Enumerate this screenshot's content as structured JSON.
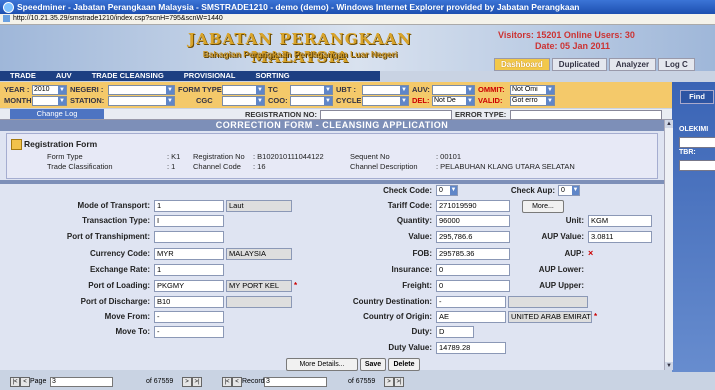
{
  "window": {
    "title": "Speedminer - Jabatan Perangkaan Malaysia - SMSTRADE1210 - demo (demo) - Windows Internet Explorer provided by Jabatan Perangkaan",
    "url": "http://10.21.35.29/smstrade1210/index.csp?scnH=795&scnW=1440"
  },
  "header": {
    "agency": "JABATAN PERANGKAAN MALAYSIA",
    "subtitle": "Bahagian Perangkaan Perdagangan Luar Negeri",
    "visitors": "Visitors: 15201  Online Users: 30",
    "date": "Date: 05 Jan 2011",
    "tabs": [
      "Dashboard",
      "Duplicated",
      "Analyzer",
      "Log C"
    ]
  },
  "menu": [
    "TRADE",
    "AUV",
    "TRADE CLEANSING",
    "PROVISIONAL",
    "SORTING"
  ],
  "filters": {
    "year_label": "YEAR :",
    "year_value": "2010",
    "month_label": "MONTH:",
    "negeri_label": "NEGERI :",
    "station_label": "STATION:",
    "form_type_label": "FORM TYPE:",
    "cgc_label": "CGC",
    "tc_label": "TC",
    "coo_label": "COO:",
    "ubt_label": "UBT :",
    "cycle_label": "CYCLE:",
    "auv_label": "AUV:",
    "del_label": "DEL:",
    "del_value": "Not De",
    "ommit_label": "OMMIT:",
    "ommit_value": "Not Omi",
    "valid_label": "VALID:",
    "valid_value": "Got erro"
  },
  "side": {
    "find": "Find",
    "olekim": "OLEKIMI",
    "tbr": "TBR:"
  },
  "regbar": {
    "change_log": "Change Log",
    "reg_no_label": "REGISTRATION NO:",
    "error_type_label": "ERROR TYPE:"
  },
  "form_title": "CORRECTION FORM - CLEANSING APPLICATION",
  "registration": {
    "title": "Registration Form",
    "form_type_label": "Form Type",
    "form_type_value": ": K1",
    "reg_no_label": "Registration No",
    "reg_no_value": ": B102010111044122",
    "sequent_label": "Sequent No",
    "sequent_value": ": 00101",
    "trade_class_label": "Trade Classification",
    "trade_class_value": ": 1",
    "channel_code_label": "Channel Code",
    "channel_code_value": ": 16",
    "channel_desc_label": "Channel Description",
    "channel_desc_value": ": PELABUHAN KLANG UTARA SELATAN"
  },
  "checks": {
    "check_code_label": "Check Code:",
    "check_code_value": "0",
    "check_aup_label": "Check Aup:",
    "check_aup_value": "0"
  },
  "left": {
    "mode_label": "Mode of Transport:",
    "mode_value": "1",
    "mode_desc": "Laut",
    "trans_type_label": "Transaction Type:",
    "trans_type_value": "I",
    "transhipment_label": "Port of Transhipment:",
    "transhipment_value": "",
    "currency_label": "Currency Code:",
    "currency_value": "MYR",
    "currency_desc": "MALAYSIA",
    "exchange_label": "Exchange Rate:",
    "exchange_value": "1",
    "loading_label": "Port of Loading:",
    "loading_value": "PKGMY",
    "loading_desc": "MY PORT KEL",
    "discharge_label": "Port of Discharge:",
    "discharge_value": "B10",
    "move_from_label": "Move From:",
    "move_from_value": "-",
    "move_to_label": "Move To:",
    "move_to_value": "-"
  },
  "middle": {
    "tariff_label": "Tariff Code:",
    "tariff_value": "271019590",
    "more": "More...",
    "quantity_label": "Quantity:",
    "quantity_value": "96000",
    "value_label": "Value:",
    "value_value": "295,786.6",
    "fob_label": "FOB:",
    "fob_value": "295785.36",
    "insurance_label": "Insurance:",
    "insurance_value": "0",
    "freight_label": "Freight:",
    "freight_value": "0",
    "country_dest_label": "Country Destination:",
    "country_dest_value": "-",
    "country_origin_label": "Country of Origin:",
    "country_origin_value": "AE",
    "country_origin_desc": "UNITED ARAB EMIRATE!",
    "duty_label": "Duty:",
    "duty_value": "D",
    "duty_value_label": "Duty Value:",
    "duty_value_value": "14789.28"
  },
  "right": {
    "unit_label": "Unit:",
    "unit_value": "KGM",
    "aup_value_label": "AUP Value:",
    "aup_value_value": "3.0811",
    "aup_label": "AUP:",
    "aup_mark": "×",
    "aup_lower_label": "AUP Lower:",
    "aup_upper_label": "AUP Upper:"
  },
  "buttons": {
    "more_details": "More Details...",
    "save": "Save",
    "delete": "Delete"
  },
  "pager": {
    "page_label": "Page",
    "page_value": "3",
    "page_total": "of 67559",
    "record_label": "Record",
    "record_value": "3",
    "record_total": "of 67559"
  },
  "required_mark": "*"
}
